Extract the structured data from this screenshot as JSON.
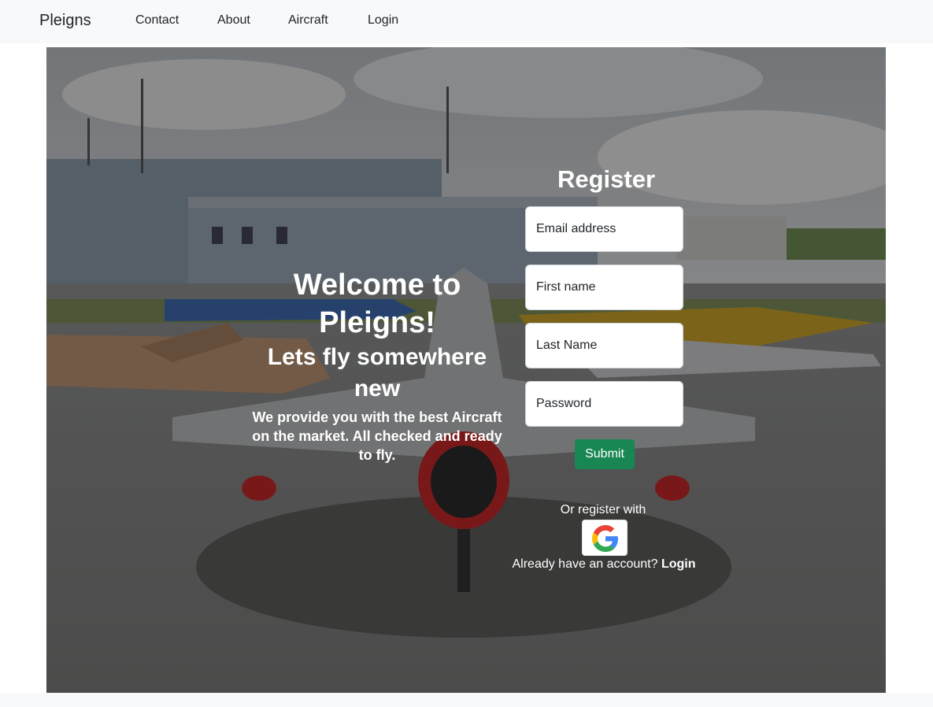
{
  "nav": {
    "brand": "Pleigns",
    "links": [
      "Contact",
      "About",
      "Aircraft",
      "Login"
    ]
  },
  "hero": {
    "title": "Welcome to Pleigns!",
    "subtitle": "Lets fly somewhere new",
    "description": "We provide you with the best Aircraft on the market. All checked and ready to fly."
  },
  "register": {
    "heading": "Register",
    "email_placeholder": "Email address",
    "first_name_placeholder": "First name",
    "last_name_placeholder": "Last Name",
    "password_placeholder": "Password",
    "submit_label": "Submit",
    "or_register_with": "Or register with",
    "have_account": "Already have an account?",
    "login_link": "Login"
  },
  "colors": {
    "navbar_bg": "#f8f9fa",
    "submit_green": "#198754"
  },
  "icons": {
    "google": "google-icon"
  }
}
